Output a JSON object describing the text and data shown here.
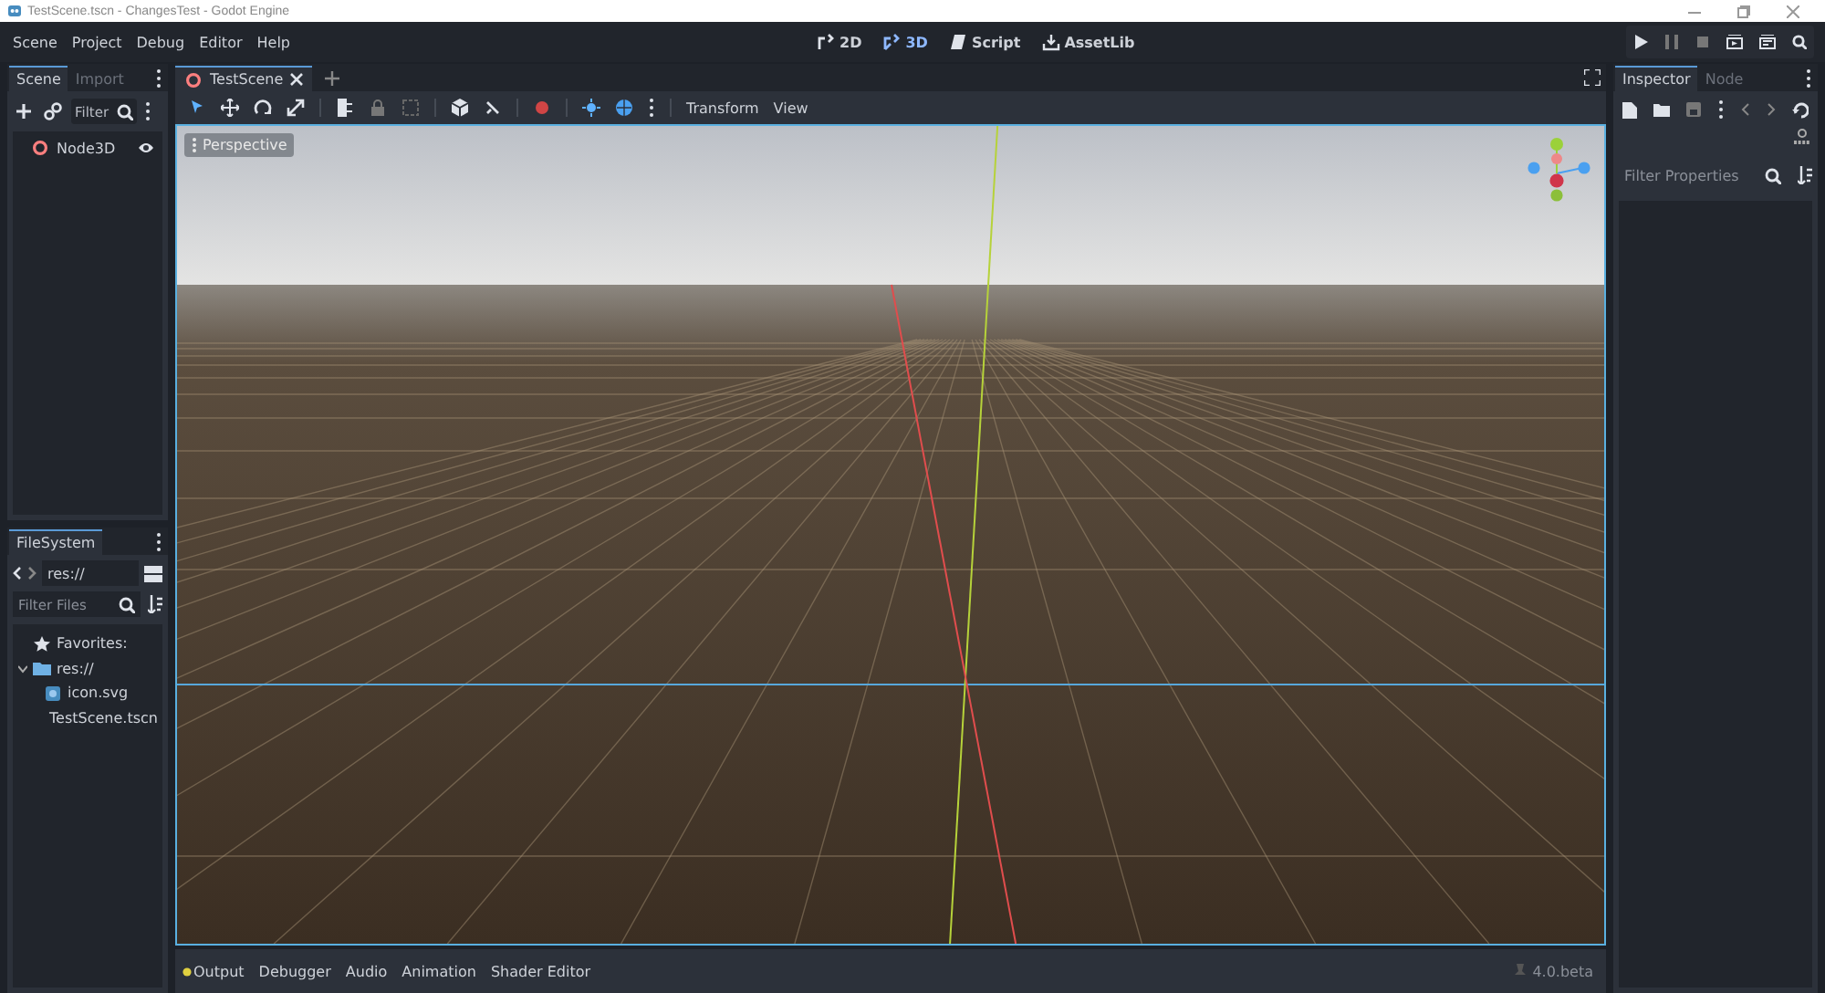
{
  "window": {
    "title": "TestScene.tscn - ChangesTest - Godot Engine"
  },
  "menu": [
    "Scene",
    "Project",
    "Debug",
    "Editor",
    "Help"
  ],
  "workspaces": [
    {
      "label": "2D",
      "kind": "view2d",
      "selected": false
    },
    {
      "label": "3D",
      "kind": "view3d",
      "selected": true
    },
    {
      "label": "Script",
      "kind": "script",
      "selected": false
    },
    {
      "label": "AssetLib",
      "kind": "assetlib",
      "selected": false
    }
  ],
  "scene_dock": {
    "tabs": [
      {
        "label": "Scene",
        "selected": true
      },
      {
        "label": "Import",
        "selected": false
      }
    ],
    "filter": {
      "placeholder": "Filter"
    },
    "tree": [
      {
        "name": "Node3D",
        "visible": true
      }
    ]
  },
  "filesystem": {
    "tabs": [
      {
        "label": "FileSystem",
        "selected": true
      }
    ],
    "path": "res://",
    "filter": {
      "placeholder": "Filter Files"
    },
    "tree": [
      {
        "label": "Favorites:",
        "kind": "favorites"
      },
      {
        "label": "res://",
        "kind": "folder",
        "expanded": true,
        "children": [
          {
            "label": "icon.svg",
            "kind": "image"
          },
          {
            "label": "TestScene.tscn",
            "kind": "scene"
          }
        ]
      }
    ]
  },
  "editor_tabs": [
    {
      "label": "TestScene",
      "selected": true
    }
  ],
  "toolbar": {
    "tools": [
      {
        "kind": "select",
        "selected": true
      },
      {
        "kind": "move",
        "selected": false
      },
      {
        "kind": "rotate",
        "selected": false
      },
      {
        "kind": "scale",
        "selected": false
      }
    ],
    "menus": [
      "Transform",
      "View"
    ]
  },
  "viewport": {
    "label": "Perspective"
  },
  "inspector": {
    "tabs": [
      {
        "label": "Inspector",
        "selected": true
      },
      {
        "label": "Node",
        "selected": false
      }
    ],
    "filter": {
      "placeholder": "Filter Properties"
    }
  },
  "bottom_panel": {
    "tabs": [
      {
        "label": "Output",
        "notify": true
      },
      {
        "label": "Debugger",
        "notify": false
      },
      {
        "label": "Audio",
        "notify": false
      },
      {
        "label": "Animation",
        "notify": false
      },
      {
        "label": "Shader Editor",
        "notify": false
      }
    ],
    "version": "4.0.beta"
  }
}
